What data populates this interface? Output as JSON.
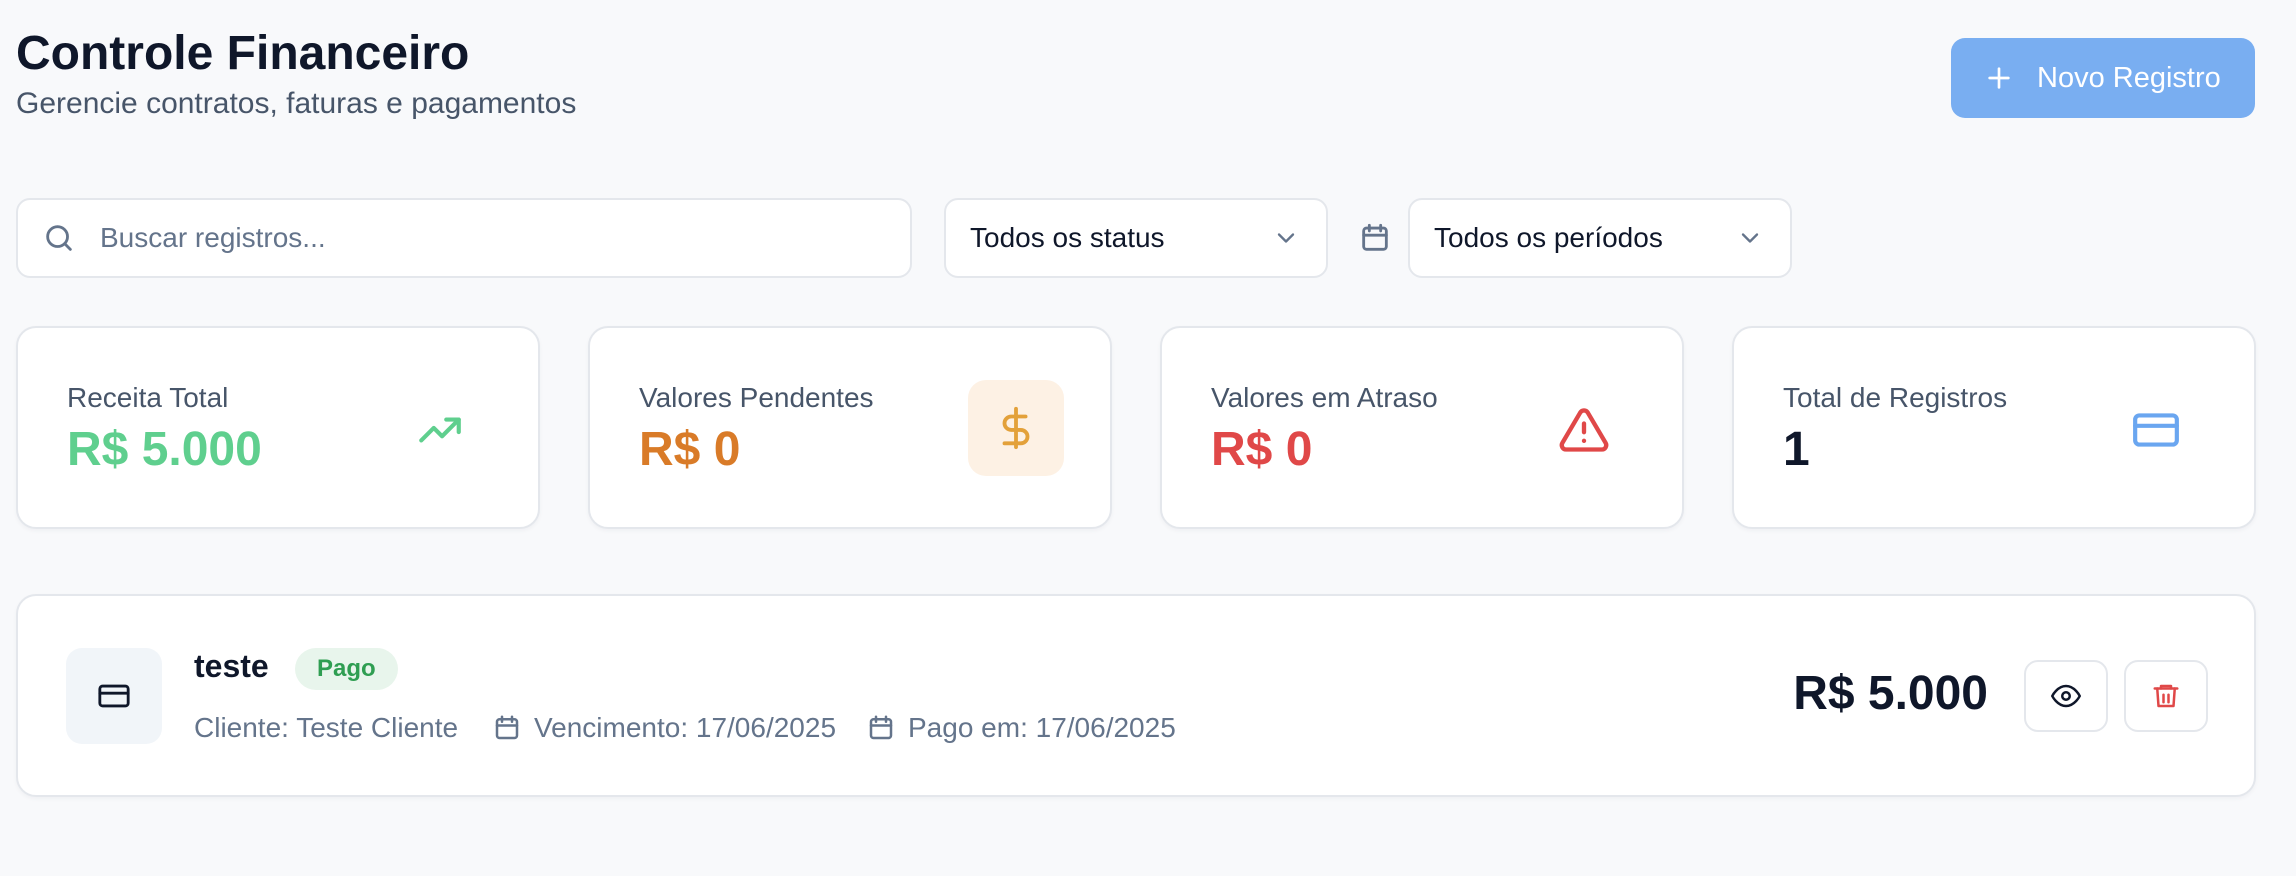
{
  "header": {
    "title": "Controle Financeiro",
    "subtitle": "Gerencie contratos, faturas e pagamentos",
    "new_button_label": "Novo Registro"
  },
  "filters": {
    "search_placeholder": "Buscar registros...",
    "search_value": "",
    "status_selected": "Todos os status",
    "period_selected": "Todos os períodos"
  },
  "stats": [
    {
      "label": "Receita Total",
      "value": "R$ 5.000",
      "color": "#5fcf8e",
      "icon": "trending-up-icon"
    },
    {
      "label": "Valores Pendentes",
      "value": "R$ 0",
      "color": "#d97b28",
      "icon": "dollar-icon"
    },
    {
      "label": "Valores em Atraso",
      "value": "R$ 0",
      "color": "#e04848",
      "icon": "alert-triangle-icon"
    },
    {
      "label": "Total de Registros",
      "value": "1",
      "color": "#0f172a",
      "icon": "credit-card-icon"
    }
  ],
  "records": [
    {
      "name": "teste",
      "status": "Pago",
      "client": "Cliente: Teste Cliente",
      "due": "Vencimento: 17/06/2025",
      "paid": "Pago em: 17/06/2025",
      "amount": "R$ 5.000"
    }
  ],
  "colors": {
    "primary": "#79aef1",
    "success": "#2f9e52",
    "warning": "#d97b28",
    "danger": "#e04848"
  }
}
